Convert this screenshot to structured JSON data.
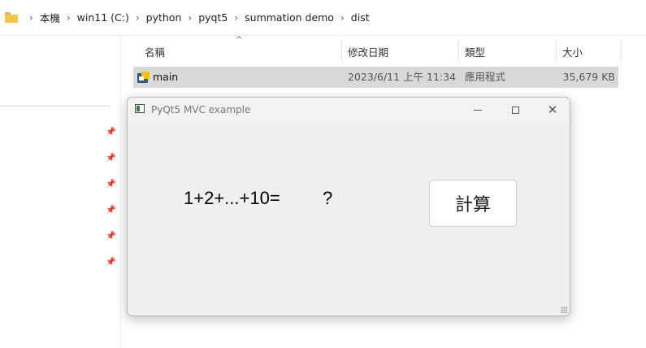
{
  "explorer": {
    "breadcrumb": [
      "本機",
      "win11 (C:)",
      "python",
      "pyqt5",
      "summation demo",
      "dist"
    ],
    "columns": [
      "名稱",
      "修改日期",
      "類型",
      "大小"
    ],
    "rows": [
      {
        "name": "main",
        "modified": "2023/6/11 上午 11:34",
        "type": "應用程式",
        "size": "35,679 KB"
      }
    ]
  },
  "window": {
    "title": "PyQt5 MVC example",
    "expression": "1+2+...+10=",
    "result": "?",
    "button_label": "計算"
  },
  "icons": {
    "folder": "folder-icon",
    "app": "app-icon",
    "pin": "pin-icon",
    "minimize": "minimize-icon",
    "maximize": "maximize-icon",
    "close": "close-icon"
  },
  "colors": {
    "selected_row": "#d9d9d9",
    "window_bg": "#f0f0f0"
  }
}
